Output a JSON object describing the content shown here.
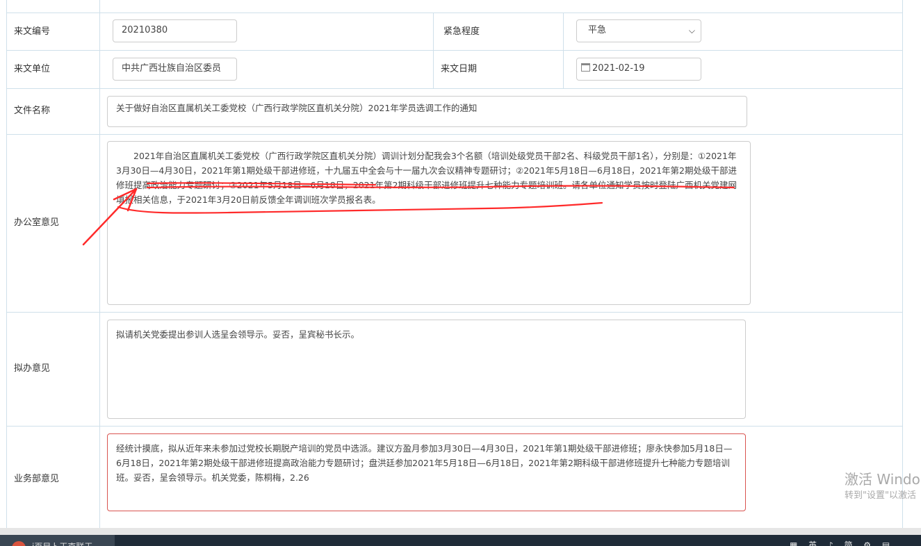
{
  "form": {
    "doc_number_label": "来文编号",
    "doc_number_value": "20210380",
    "urgency_label": "紧急程度",
    "urgency_value": "平急",
    "source_unit_label": "来文单位",
    "source_unit_value": "中共广西壮族自治区委员",
    "doc_date_label": "来文日期",
    "doc_date_value": "2021-02-19",
    "file_name_label": "文件名称",
    "file_name_value": "关于做好自治区直属机关工委党校（广西行政学院区直机关分院）2021年学员选调工作的通知",
    "office_opinion_label": "办公室意见",
    "office_opinion_value": "2021年自治区直属机关工委党校（广西行政学院区直机关分院）调训计划分配我会3个名额（培训处级党员干部2名、科级党员干部1名），分别是：①2021年3月30日—4月30日，2021年第1期处级干部进修班，十九届五中全会与十一届九次会议精神专题研讨；②2021年5月18日—6月18日，2021年第2期处级干部进修班提高政治能力专题研讨；③2021年5月18日—6月18日，2021年第2期科级干部进修班提升七种能力专题培训班。请各单位通知学员按时登陆广西机关党建网填报相关信息，于2021年3月20日前反馈全年调训班次学员报名表。",
    "draft_opinion_label": "拟办意见",
    "draft_opinion_value": "拟请机关党委提出参训人选呈会领导示。妥否，呈宾秘书长示。",
    "business_opinion_label": "业务部意见",
    "business_opinion_value": "经统计摸底，拟从近年来未参加过党校长期脱产培训的党员中选派。建议方盈月参加3月30日—4月30日，2021年第1期处级干部进修班；廖永快参加5月18日—6月18日，2021年第2期处级干部进修班提高政治能力专题研讨；盘洪廷参加2021年5月18日—6月18日，2021年第2期科级干部进修班提升七种能力专题培训班。妥否，呈会领导示。机关党委，陈桐梅，2.26"
  },
  "watermark": {
    "line1": "激活 Windo",
    "line2": "转到\"设置\"以激活"
  },
  "taskbar": {
    "item_label": "i页目卜干克联王",
    "tray_text": "▦ 英 ♪ 简 ⚙ ▤"
  },
  "colors": {
    "border": "#cfe0ea",
    "annotation": "#ff2a2a",
    "danger_border": "#d9534f"
  }
}
